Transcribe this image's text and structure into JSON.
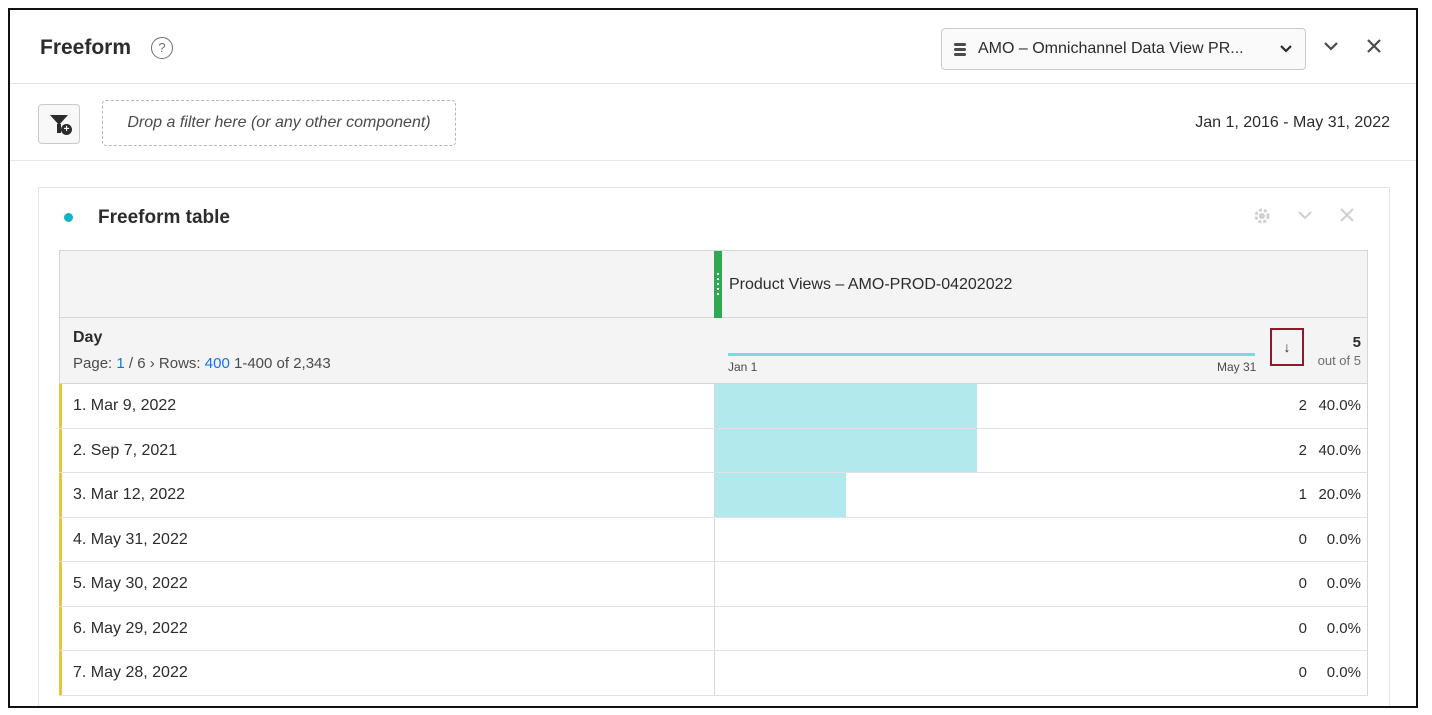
{
  "header": {
    "title": "Freeform",
    "help_icon": "?",
    "data_view": "AMO – Omnichannel Data View PR...",
    "collapse_icon": "chevron-down",
    "close_icon": "close"
  },
  "filterbar": {
    "drop_hint": "Drop a filter here (or any other component)",
    "date_range": "Jan 1, 2016 - May 31, 2022"
  },
  "panel": {
    "title": "Freeform table",
    "settings_icon": "gear",
    "collapse_icon": "chevron-down",
    "close_icon": "close",
    "metric": "Product Views – AMO-PROD-04202022",
    "dimension": "Day",
    "pager": {
      "page_label": "Page:",
      "page": "1",
      "page_sep": "/ 6",
      "next": "›",
      "rows_label": "Rows:",
      "rows": "400",
      "range": "1-400 of 2,343"
    },
    "sparkline": {
      "start": "Jan 1",
      "end": "May 31"
    },
    "sort_icon": "↓",
    "total": "5",
    "total_of": "out of 5",
    "rows": [
      {
        "label": "1.  Mar 9, 2022",
        "value": "2",
        "pct": "40.0%",
        "fraction": 0.4
      },
      {
        "label": "2.  Sep 7, 2021",
        "value": "2",
        "pct": "40.0%",
        "fraction": 0.4
      },
      {
        "label": "3.  Mar 12, 2022",
        "value": "1",
        "pct": "20.0%",
        "fraction": 0.2
      },
      {
        "label": "4.  May 31, 2022",
        "value": "0",
        "pct": "0.0%",
        "fraction": 0
      },
      {
        "label": "5.  May 30, 2022",
        "value": "0",
        "pct": "0.0%",
        "fraction": 0
      },
      {
        "label": "6.  May 29, 2022",
        "value": "0",
        "pct": "0.0%",
        "fraction": 0
      },
      {
        "label": "7.  May 28, 2022",
        "value": "0",
        "pct": "0.0%",
        "fraction": 0
      }
    ]
  },
  "colors": {
    "bar": "#b1e9ed",
    "accent": "#e8c53a",
    "metric_handle": "#33a853",
    "link": "#1473e6"
  }
}
